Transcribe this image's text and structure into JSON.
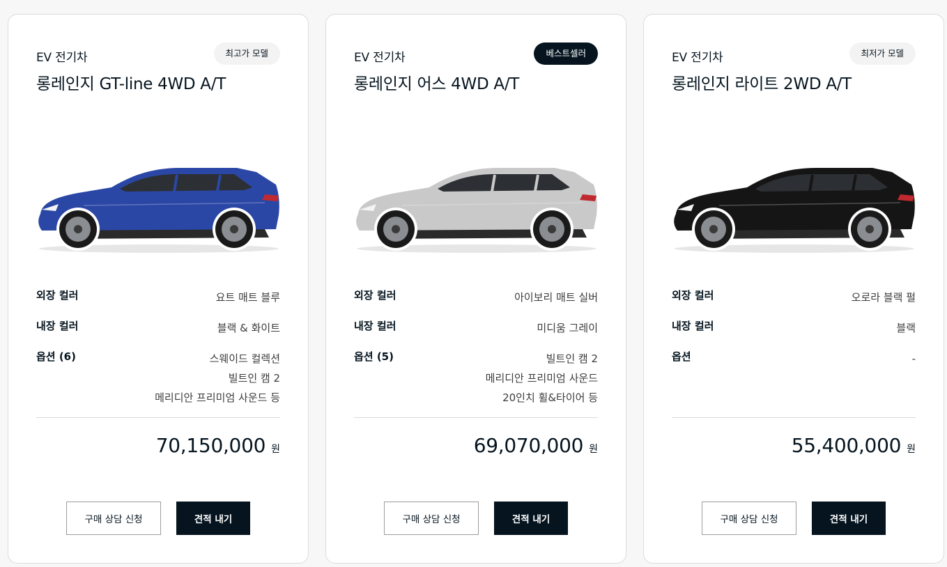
{
  "cards": [
    {
      "category": "EV 전기차",
      "badge": "최고가 모델",
      "badge_style": "light",
      "model": "롱레인지 GT-line 4WD A/T",
      "car_color": "#2b47a6",
      "specs": {
        "exterior_label": "외장 컬러",
        "exterior_value": "요트 매트 블루",
        "interior_label": "내장 컬러",
        "interior_value": "블랙 & 화이트",
        "options_label": "옵션 (6)",
        "options_values": [
          "스웨이드 컬렉션",
          "빌트인 캠 2",
          "메리디안 프리미엄 사운드 등"
        ]
      },
      "price": "70,150,000",
      "price_unit": "원",
      "consult_label": "구매 상담 신청",
      "estimate_label": "견적 내기"
    },
    {
      "category": "EV 전기차",
      "badge": "베스트셀러",
      "badge_style": "dark",
      "model": "롱레인지 어스 4WD A/T",
      "car_color": "#c9c9c9",
      "specs": {
        "exterior_label": "외장 컬러",
        "exterior_value": "아이보리 매트 실버",
        "interior_label": "내장 컬러",
        "interior_value": "미디움 그레이",
        "options_label": "옵션 (5)",
        "options_values": [
          "빌트인 캠 2",
          "메리디안 프리미엄 사운드",
          "20인치 휠&타이어 등"
        ]
      },
      "price": "69,070,000",
      "price_unit": "원",
      "consult_label": "구매 상담 신청",
      "estimate_label": "견적 내기"
    },
    {
      "category": "EV 전기차",
      "badge": "최저가 모델",
      "badge_style": "light",
      "model": "롱레인지 라이트 2WD A/T",
      "car_color": "#151515",
      "specs": {
        "exterior_label": "외장 컬러",
        "exterior_value": "오로라 블랙 펄",
        "interior_label": "내장 컬러",
        "interior_value": "블랙",
        "options_label": "옵션",
        "options_values": [
          "-"
        ]
      },
      "price": "55,400,000",
      "price_unit": "원",
      "consult_label": "구매 상담 신청",
      "estimate_label": "견적 내기"
    }
  ]
}
